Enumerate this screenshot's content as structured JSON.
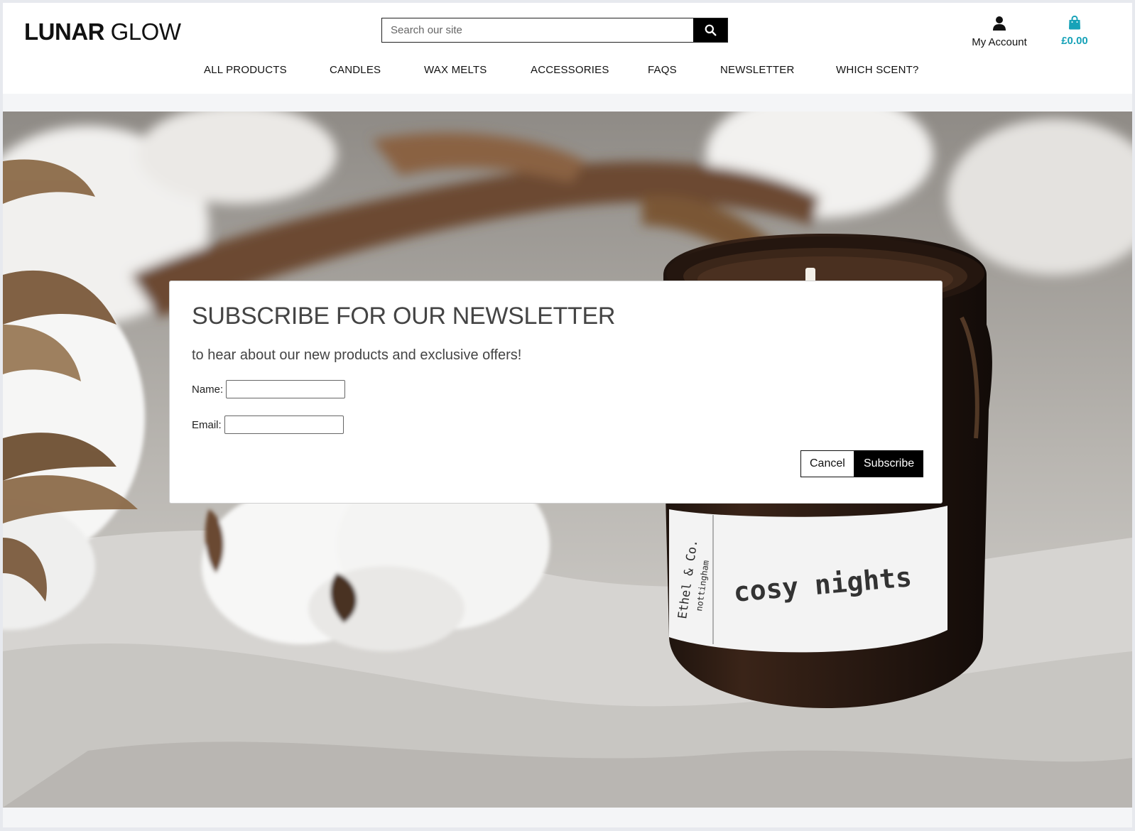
{
  "header": {
    "logo_bold": "LUNAR",
    "logo_light": "GLOW",
    "search": {
      "placeholder": "Search our site",
      "value": ""
    },
    "account_label": "My Account",
    "bag_total": "£0.00",
    "accent_color": "#17a2b8"
  },
  "nav": {
    "items": [
      {
        "label": "ALL PRODUCTS"
      },
      {
        "label": "CANDLES"
      },
      {
        "label": "WAX MELTS"
      },
      {
        "label": "ACCESSORIES"
      },
      {
        "label": "FAQS"
      },
      {
        "label": "NEWSLETTER"
      },
      {
        "label": "WHICH SCENT?"
      }
    ]
  },
  "hero": {
    "candle_brand": "Ethel & Co.",
    "candle_city": "nottingham",
    "candle_scent": "cosy nights"
  },
  "modal": {
    "title": "SUBSCRIBE FOR OUR NEWSLETTER",
    "subtitle": "to hear about our new products and exclusive offers!",
    "name_label": "Name:",
    "name_value": "",
    "email_label": "Email:",
    "email_value": "",
    "cancel_label": "Cancel",
    "subscribe_label": "Subscribe"
  }
}
